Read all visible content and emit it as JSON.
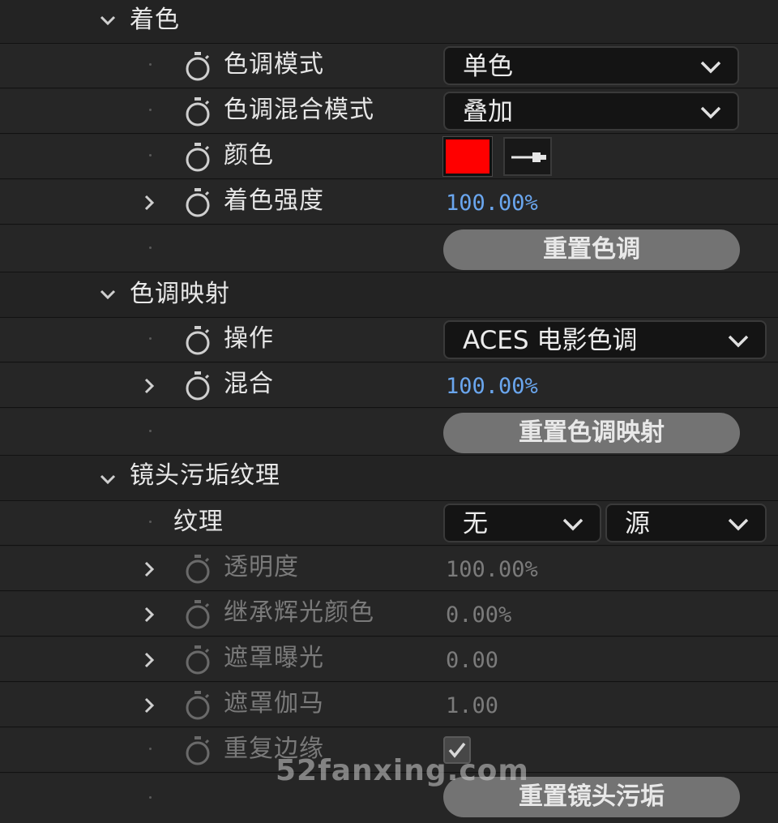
{
  "sections": {
    "tint": {
      "title": "着色",
      "tint_mode": {
        "label": "色调模式",
        "value": "单色"
      },
      "tint_blend_mode": {
        "label": "色调混合模式",
        "value": "叠加"
      },
      "color": {
        "label": "颜色",
        "swatch_color": "#ff0000"
      },
      "tint_strength": {
        "label": "着色强度",
        "value": "100.00%"
      },
      "reset_button": "重置色调"
    },
    "tone_mapping": {
      "title": "色调映射",
      "operation": {
        "label": "操作",
        "value": "ACES 电影色调"
      },
      "blend": {
        "label": "混合",
        "value": "100.00%"
      },
      "reset_button": "重置色调映射"
    },
    "lens_dirt": {
      "title": "镜头污垢纹理",
      "texture": {
        "label": "纹理",
        "value": "无",
        "source": "源"
      },
      "opacity": {
        "label": "透明度",
        "value": "100.00%"
      },
      "inherit_glow_color": {
        "label": "继承辉光颜色",
        "value": "0.00%"
      },
      "mask_exposure": {
        "label": "遮罩曝光",
        "value": "0.00"
      },
      "mask_gamma": {
        "label": "遮罩伽马",
        "value": "1.00"
      },
      "repeat_edges": {
        "label": "重复边缘",
        "checked": true
      },
      "reset_button": "重置镜头污垢"
    }
  },
  "watermark": "52fanxing.com",
  "colors": {
    "value_blue": "#6aa6ee",
    "button_gray": "#737373",
    "background": "#232323"
  }
}
